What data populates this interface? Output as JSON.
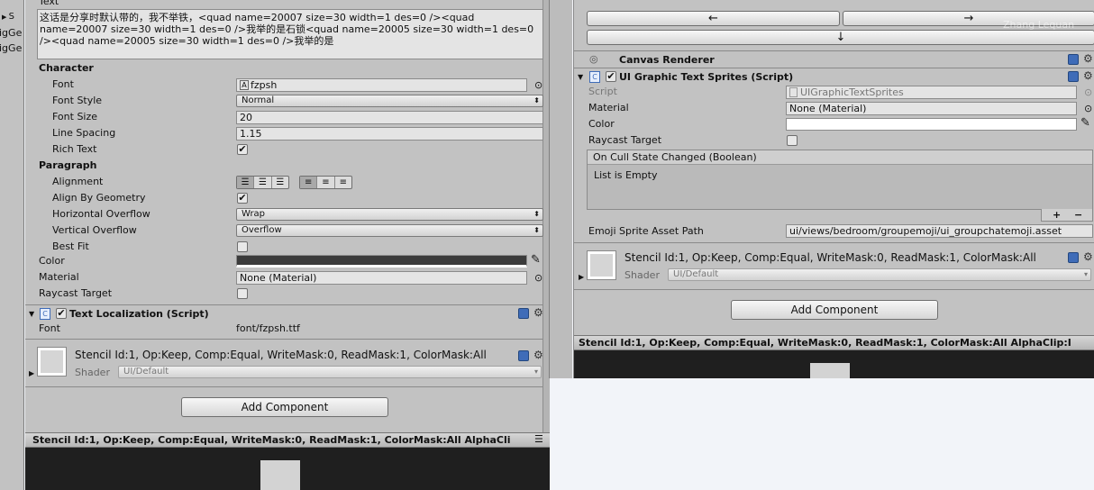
{
  "hierarchy": {
    "items": [
      "S",
      "igGe",
      "igGe"
    ]
  },
  "left": {
    "text_label": "Text",
    "text_value": "这话是分享时默认带的，我不举铁，<quad name=20007 size=30 width=1 des=0 /><quad\nname=20007 size=30 width=1 des=0 />我举的是石锁<quad name=20005 size=30 width=1 des=0\n/><quad name=20005 size=30 width=1 des=0 />我举的是",
    "character": {
      "header": "Character",
      "font_label": "Font",
      "font_value": "fzpsh",
      "style_label": "Font Style",
      "style_value": "Normal",
      "size_label": "Font Size",
      "size_value": "20",
      "spacing_label": "Line Spacing",
      "spacing_value": "1.15",
      "rich_label": "Rich Text",
      "rich_checked": "✔"
    },
    "paragraph": {
      "header": "Paragraph",
      "align_label": "Alignment",
      "geom_label": "Align By Geometry",
      "geom_checked": "✔",
      "hover_label": "Horizontal Overflow",
      "hover_value": "Wrap",
      "vover_label": "Vertical Overflow",
      "vover_value": "Overflow",
      "bestfit_label": "Best Fit"
    },
    "color_label": "Color",
    "material_label": "Material",
    "material_value": "None (Material)",
    "raycast_label": "Raycast Target",
    "localization": {
      "title": "Text Localization (Script)",
      "font_label": "Font",
      "font_value": "font/fzpsh.ttf"
    },
    "stencil": {
      "text": "Stencil Id:1, Op:Keep, Comp:Equal, WriteMask:0, ReadMask:1, ColorMask:All",
      "shader_label": "Shader",
      "shader_value": "UI/Default"
    },
    "add_component": "Add Component",
    "preview_title": "Stencil Id:1, Op:Keep, Comp:Equal, WriteMask:0, ReadMask:1, ColorMask:All AlphaCli"
  },
  "right": {
    "arrows": {
      "left": "←",
      "right": "→",
      "down": "↓"
    },
    "watermark": "Zhang Lequan",
    "canvas_renderer": "Canvas Renderer",
    "sprites": {
      "title": "UI Graphic Text Sprites (Script)",
      "script_label": "Script",
      "script_value": "UIGraphicTextSprites",
      "material_label": "Material",
      "material_value": "None (Material)",
      "color_label": "Color",
      "raycast_label": "Raycast Target",
      "event_title": "On Cull State Changed (Boolean)",
      "event_empty": "List is Empty",
      "plus": "+",
      "minus": "−",
      "emoji_label": "Emoji Sprite Asset Path",
      "emoji_value": "ui/views/bedroom/groupemoji/ui_groupchatemoji.asset"
    },
    "stencil": {
      "text": "Stencil Id:1, Op:Keep, Comp:Equal, WriteMask:0, ReadMask:1, ColorMask:All",
      "shader_label": "Shader",
      "shader_value": "UI/Default"
    },
    "add_component": "Add Component",
    "preview_title": "Stencil Id:1, Op:Keep, Comp:Equal, WriteMask:0, ReadMask:1, ColorMask:All AlphaClip:I"
  }
}
